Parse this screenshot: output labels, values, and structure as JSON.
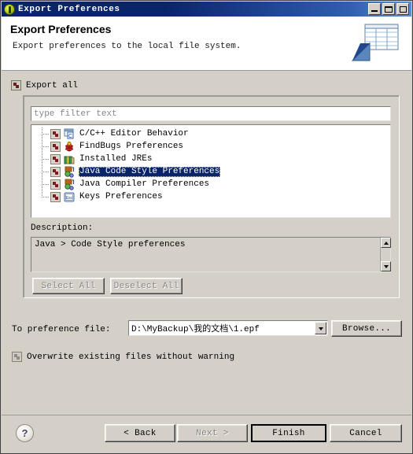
{
  "window": {
    "title": "Export Preferences",
    "icon": "eclipse-export-icon",
    "controls": {
      "minimize": "Minimize",
      "maximize": "Maximize",
      "close": "Close"
    }
  },
  "header": {
    "title": "Export Preferences",
    "subtitle": "Export preferences to the local file system.",
    "banner_icon": "export-table-icon"
  },
  "export_all": {
    "label": "Export all",
    "checked": false,
    "icon": "checkbox-icon"
  },
  "filter": {
    "placeholder": "type filter text",
    "value": ""
  },
  "tree": {
    "items": [
      {
        "label": "C/C++ Editor Behavior",
        "icon": "cpp-editor-icon",
        "checked": false,
        "selected": false
      },
      {
        "label": "FindBugs Preferences",
        "icon": "findbugs-bug-icon",
        "checked": false,
        "selected": false
      },
      {
        "label": "Installed JREs",
        "icon": "installed-jres-icon",
        "checked": false,
        "selected": false
      },
      {
        "label": "Java Code Style Preferences",
        "icon": "java-code-style-icon",
        "checked": false,
        "selected": true
      },
      {
        "label": "Java Compiler Preferences",
        "icon": "java-compiler-icon",
        "checked": false,
        "selected": false
      },
      {
        "label": "Keys Preferences",
        "icon": "keys-esc-icon",
        "checked": false,
        "selected": false
      }
    ]
  },
  "description": {
    "label": "Description:",
    "text": "Java > Code Style preferences"
  },
  "buttons": {
    "select_all": {
      "label": "Select All",
      "enabled": false
    },
    "deselect_all": {
      "label": "Deselect All",
      "enabled": false
    },
    "browse": {
      "label": "Browse...",
      "enabled": true
    }
  },
  "preference_file": {
    "label": "To preference file:",
    "value": "D:\\MyBackup\\我的文档\\1.epf"
  },
  "overwrite": {
    "label": "Overwrite existing files without warning",
    "checked": false
  },
  "footer": {
    "help": "?",
    "back": {
      "label": "< Back",
      "enabled": true
    },
    "next": {
      "label": "Next >",
      "enabled": false
    },
    "finish": {
      "label": "Finish",
      "enabled": true,
      "default": true
    },
    "cancel": {
      "label": "Cancel",
      "enabled": true
    }
  },
  "colors": {
    "title_bar": "#0a246a",
    "dialog_bg": "#d4d0c8",
    "selection": "#0a246a",
    "field_bg": "#ffffff",
    "disabled_text": "#868686"
  }
}
